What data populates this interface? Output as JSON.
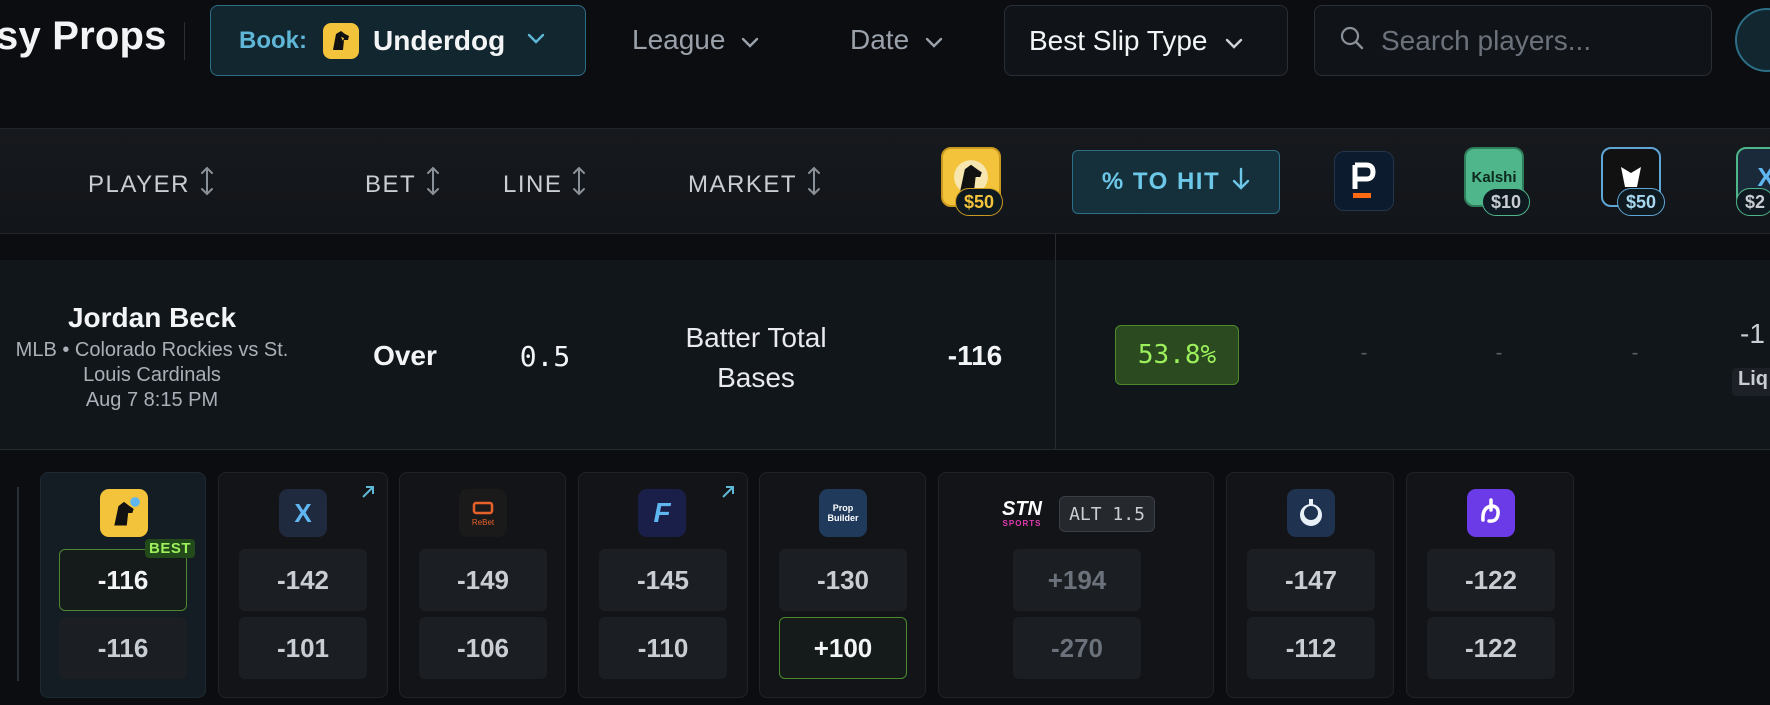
{
  "toolbar": {
    "brand": "sy Props",
    "book_label": "Book:",
    "book_value": "Underdog",
    "league": "League",
    "date": "Date",
    "slip_type": "Best Slip Type",
    "search_placeholder": "Search players..."
  },
  "columns": {
    "player": "PLAYER",
    "bet": "BET",
    "line": "LINE",
    "market": "MARKET",
    "to_hit": "% TO HIT"
  },
  "header_books": [
    {
      "icon": "underdog-logo-icon",
      "stake": "$50"
    },
    {
      "icon": "prizepicks-logo-icon",
      "stake": ""
    },
    {
      "icon": "kalshi-logo-icon",
      "label": "Kalshi",
      "stake": "$10"
    },
    {
      "icon": "sleeper-logo-icon",
      "stake": "$50"
    },
    {
      "icon": "x-book-logo-icon",
      "label": "X",
      "stake": "$2"
    }
  ],
  "player": {
    "name": "Jordan Beck",
    "sub_line1": "MLB • Colorado Rockies vs St.",
    "sub_line2": "Louis Cardinals",
    "time": "Aug 7 8:15 PM",
    "bet": "Over",
    "line": "0.5",
    "market_line1": "Batter Total",
    "market_line2": "Bases",
    "odds": "-116",
    "to_hit": "53.8%",
    "dash": "-",
    "edge_odds": "-1",
    "edge_badge": "Liq"
  },
  "books": [
    {
      "name": "underdog",
      "icon": "underdog-logo-icon",
      "over": "-116",
      "under": "-116",
      "best": "BEST"
    },
    {
      "name": "x-book",
      "icon": "x-book-logo-icon",
      "label": "X",
      "over": "-142",
      "under": "-101"
    },
    {
      "name": "rebet",
      "icon": "rebet-logo-icon",
      "label": "ReBet",
      "over": "-149",
      "under": "-106"
    },
    {
      "name": "fliff",
      "icon": "fliff-logo-icon",
      "label": "F",
      "over": "-145",
      "under": "-110"
    },
    {
      "name": "prop-builder",
      "icon": "prop-builder-logo-icon",
      "label1": "Prop",
      "label2": "Builder",
      "over": "-130",
      "under": "+100"
    },
    {
      "name": "stn-sports",
      "icon": "stn-sports-logo-icon",
      "label1": "STN",
      "label2": "SPORTS",
      "alt": "ALT 1.5",
      "over": "+194",
      "under": "-270"
    },
    {
      "name": "sleeper-robot",
      "icon": "robot-logo-icon",
      "over": "-147",
      "under": "-112"
    },
    {
      "name": "dabble",
      "icon": "dabble-logo-icon",
      "over": "-122",
      "under": "-122"
    }
  ],
  "colors": {
    "accent": "#5fb6d6",
    "positive": "#9bf05b",
    "underdog": "#f3c33b"
  }
}
